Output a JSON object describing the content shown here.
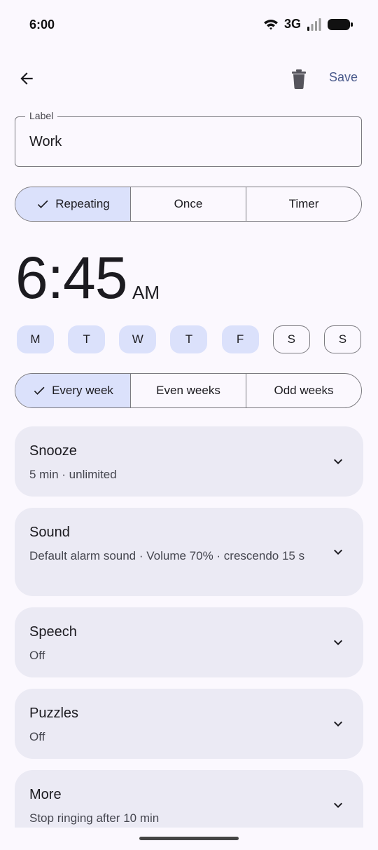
{
  "status": {
    "time": "6:00",
    "network": "3G"
  },
  "toolbar": {
    "save_label": "Save"
  },
  "label_field": {
    "caption": "Label",
    "value": "Work"
  },
  "mode": {
    "options": [
      "Repeating",
      "Once",
      "Timer"
    ],
    "selected": "Repeating"
  },
  "alarm_time": {
    "time": "6:45",
    "ampm": "AM"
  },
  "days": [
    {
      "letter": "M",
      "selected": true
    },
    {
      "letter": "T",
      "selected": true
    },
    {
      "letter": "W",
      "selected": true
    },
    {
      "letter": "T",
      "selected": true
    },
    {
      "letter": "F",
      "selected": true
    },
    {
      "letter": "S",
      "selected": false
    },
    {
      "letter": "S",
      "selected": false
    }
  ],
  "weeks": {
    "options": [
      "Every week",
      "Even weeks",
      "Odd weeks"
    ],
    "selected": "Every week"
  },
  "settings": {
    "snooze": {
      "title": "Snooze",
      "subtitle": "5 min · unlimited"
    },
    "sound": {
      "title": "Sound",
      "subtitle": "Default alarm sound · Volume 70% · crescendo 15 s"
    },
    "speech": {
      "title": "Speech",
      "subtitle": "Off"
    },
    "puzzles": {
      "title": "Puzzles",
      "subtitle": "Off"
    },
    "more": {
      "title": "More",
      "subtitle": "Stop ringing after 10 min"
    }
  },
  "colors": {
    "accent": "#dbe1fb",
    "save": "#4a5a8c",
    "card": "#ebeaf4",
    "background": "#fbf8fe"
  },
  "icons": [
    "back-arrow-icon",
    "trash-icon",
    "check-icon",
    "chevron-down-icon",
    "wifi-icon",
    "signal-icon",
    "battery-icon"
  ]
}
